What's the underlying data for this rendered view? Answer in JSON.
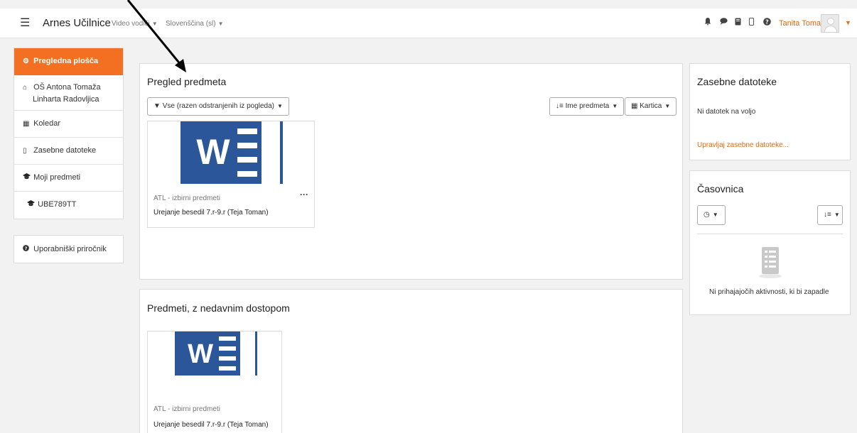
{
  "navbar": {
    "brand": "Arnes Učilnice",
    "menu_video": "Video vodiči",
    "menu_language": "Slovenščina (sl)",
    "user_name": "Tanita Toman"
  },
  "sidebar": {
    "items": [
      {
        "label": "Pregledna plošča",
        "icon": "dashboard-icon",
        "glyph": "⚙"
      },
      {
        "label_line1": "OŠ Antona Tomaža",
        "label_line2": "Linharta Radovljica",
        "icon": "home-icon",
        "glyph": "⌂"
      },
      {
        "label": "Koledar",
        "icon": "calendar-icon",
        "glyph": "▦"
      },
      {
        "label": "Zasebne datoteke",
        "icon": "file-icon",
        "glyph": "▯"
      },
      {
        "label": "Moji predmeti",
        "icon": "graduation-cap-icon",
        "glyph": "🎓"
      },
      {
        "label": "UBE789TT",
        "icon": "graduation-cap-icon",
        "glyph": "🎓"
      }
    ],
    "manual": {
      "label": "Uporabniški priročnik",
      "icon": "question-icon",
      "glyph": "?"
    }
  },
  "overview": {
    "title": "Pregled predmeta",
    "filter_label": "Vse (razen odstranjenih iz pogleda)",
    "sort_label": "Ime predmeta",
    "view_label": "Kartica",
    "course": {
      "category": "ATL - izbirni predmeti",
      "name": "Urejanje besedil 7.r-9.r (Teja Toman)"
    }
  },
  "recent": {
    "title": "Predmeti, z nedavnim dostopom",
    "course": {
      "category": "ATL - izbirni predmeti",
      "name": "Urejanje besedil 7.r-9.r (Teja Toman)"
    }
  },
  "private_files": {
    "title": "Zasebne datoteke",
    "empty_text": "Ni datotek na voljo",
    "manage_link": "Upravljaj zasebne datoteke..."
  },
  "timeline": {
    "title": "Časovnica",
    "empty_text": "Ni prihajajočih aktivnosti, ki bi zapadle"
  },
  "colors": {
    "accent": "#f36f21",
    "word_blue": "#2b579a"
  }
}
